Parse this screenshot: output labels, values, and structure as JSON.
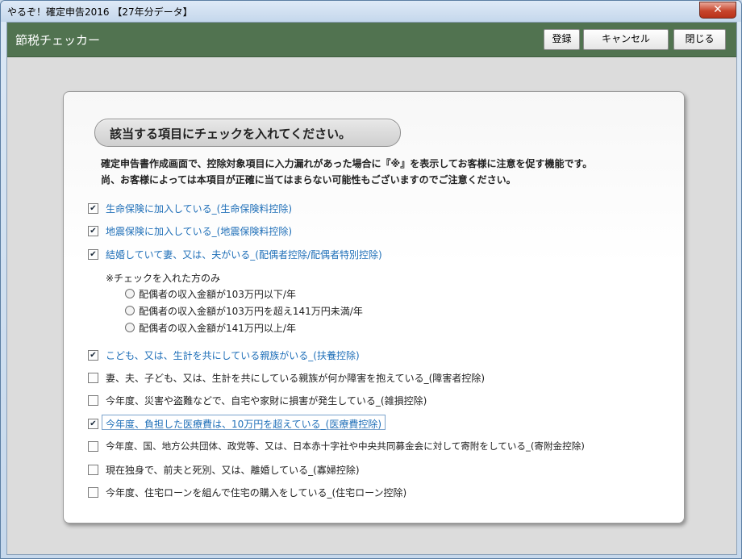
{
  "window": {
    "title": "やるぞ！確定申告2016 【27年分データ】",
    "close_label": "✕"
  },
  "toolbar": {
    "title": "節税チェッカー",
    "register_label": "登録",
    "cancel_label": "キャンセル",
    "close_label": "閉じる"
  },
  "panel": {
    "heading": "該当する項目にチェックを入れてください。",
    "desc1": "確定申告書作成画面で、控除対象項目に入力漏れがあった場合に『※』を表示してお客様に注意を促す機能です。",
    "desc2": "尚、お客様によっては本項目が正確に当てはまらない可能性もございますのでご注意ください。",
    "items": [
      {
        "label": "生命保険に加入している_(生命保険料控除)",
        "checked": true
      },
      {
        "label": "地震保険に加入している_(地震保険料控除)",
        "checked": true
      },
      {
        "label": "結婚していて妻、又は、夫がいる_(配偶者控除/配偶者特別控除)",
        "checked": true
      },
      {
        "label": "こども、又は、生計を共にしている親族がいる_(扶養控除)",
        "checked": true
      },
      {
        "label": "妻、夫、子ども、又は、生計を共にしている親族が何か障害を抱えている_(障害者控除)",
        "checked": false
      },
      {
        "label": "今年度、災害や盗難などで、自宅や家財に損害が発生している_(雑損控除)",
        "checked": false
      },
      {
        "label": "今年度、負担した医療費は、10万円を超えている_(医療費控除)",
        "checked": true
      },
      {
        "label": "今年度、国、地方公共団体、政党等、又は、日本赤十字社や中央共同募金会に対して寄附をしている_(寄附金控除)",
        "checked": false
      },
      {
        "label": "現在独身で、前夫と死別、又は、離婚している_(寡婦控除)",
        "checked": false
      },
      {
        "label": "今年度、住宅ローンを組んで住宅の購入をしている_(住宅ローン控除)",
        "checked": false
      }
    ],
    "spouse_note": "※チェックを入れた方のみ",
    "spouse_options": [
      "配偶者の収入金額が103万円以下/年",
      "配偶者の収入金額が103万円を超え141万円未満/年",
      "配偶者の収入金額が141万円以上/年"
    ],
    "check_mark": "✔"
  },
  "colors": {
    "toolbar_bg": "#517350",
    "checked_text": "#1f6fb8",
    "close_button": "#c7452c"
  }
}
